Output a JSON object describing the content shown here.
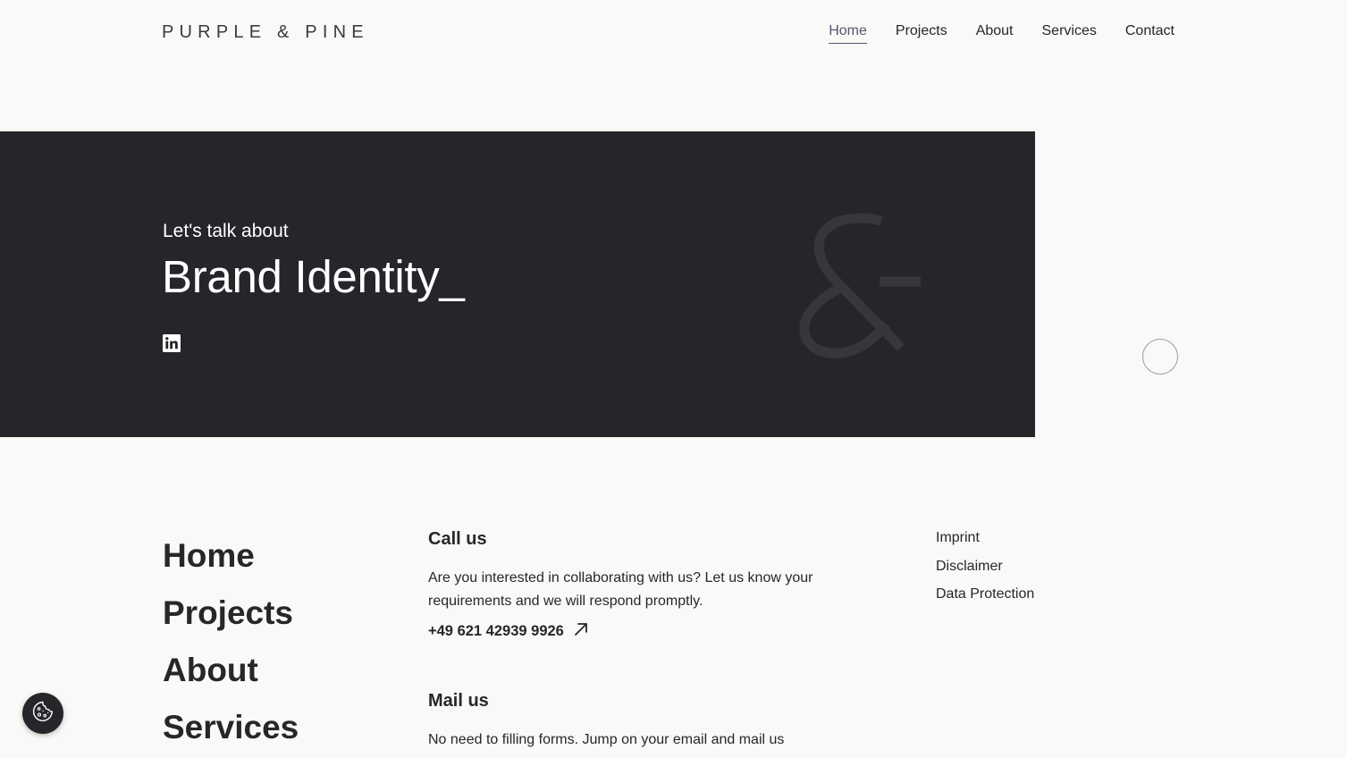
{
  "header": {
    "logo": "PURPLE & PINE",
    "nav": [
      {
        "label": "Home",
        "active": true
      },
      {
        "label": "Projects",
        "active": false
      },
      {
        "label": "About",
        "active": false
      },
      {
        "label": "Services",
        "active": false
      },
      {
        "label": "Contact",
        "active": false
      }
    ]
  },
  "hero": {
    "eyebrow": "Let's talk about",
    "title": "Brand Identity_",
    "social_icon": "linkedin-icon",
    "decor_icon": "ampersand-icon"
  },
  "footer": {
    "nav": [
      "Home",
      "Projects",
      "About",
      "Services"
    ],
    "call": {
      "heading": "Call us",
      "text": "Are you interested in collaborating with us? Let us know your requirements and we will respond promptly.",
      "phone": "+49 621 42939 9926",
      "phone_icon": "arrow-up-right-icon"
    },
    "mail": {
      "heading": "Mail us",
      "text": "No need to filling forms. Jump on your email and mail us"
    },
    "legal": [
      "Imprint",
      "Disclaimer",
      "Data Protection"
    ]
  },
  "cookie": {
    "icon": "cookie-icon"
  },
  "colors": {
    "background": "#faf9f7",
    "hero_bg": "#25262a",
    "text": "#26272b",
    "accent": "#5a5470"
  }
}
